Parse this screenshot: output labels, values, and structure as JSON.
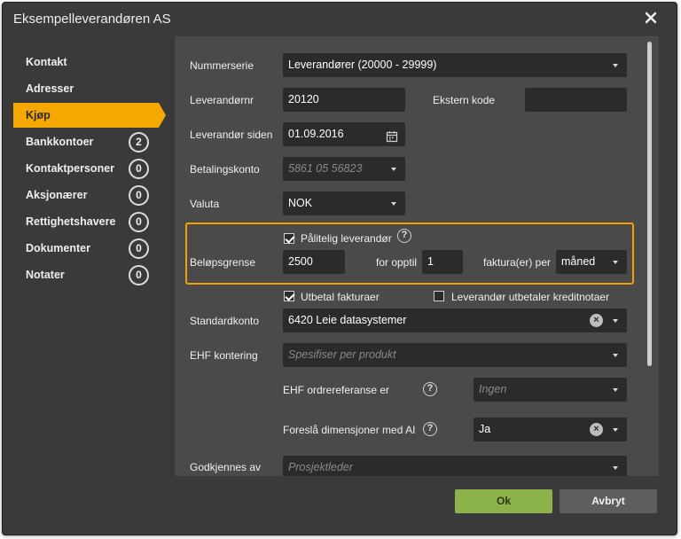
{
  "dialog": {
    "title": "Eksempelleverandøren AS"
  },
  "sidebar": {
    "items": [
      {
        "label": "Kontakt"
      },
      {
        "label": "Adresser"
      },
      {
        "label": "Kjøp"
      },
      {
        "label": "Bankkontoer",
        "count": "2"
      },
      {
        "label": "Kontaktpersoner",
        "count": "0"
      },
      {
        "label": "Aksjonærer",
        "count": "0"
      },
      {
        "label": "Rettighetshavere",
        "count": "0"
      },
      {
        "label": "Dokumenter",
        "count": "0"
      },
      {
        "label": "Notater",
        "count": "0"
      }
    ],
    "active_index": 2
  },
  "form": {
    "nummerserie": {
      "label": "Nummerserie",
      "value": "Leverandører (20000 - 29999)"
    },
    "leverandornr": {
      "label": "Leverandørnr",
      "value": "20120"
    },
    "ekstern_kode": {
      "label": "Ekstern kode",
      "value": ""
    },
    "leverandor_siden": {
      "label": "Leverandør siden",
      "value": "01.09.2016"
    },
    "betalingskonto": {
      "label": "Betalingskonto",
      "placeholder": "5861 05 56823"
    },
    "valuta": {
      "label": "Valuta",
      "value": "NOK"
    },
    "palitelig": {
      "label": "Pålitelig leverandør",
      "checked": true,
      "help": "?"
    },
    "belopsgrense": {
      "label": "Beløpsgrense",
      "value": "2500"
    },
    "for_opptil": {
      "label": "for opptil",
      "value": "1"
    },
    "fakturaer_per": {
      "label": "faktura(er) per",
      "value": "måned"
    },
    "utbetal_fakturaer": {
      "label": "Utbetal fakturaer",
      "checked": true
    },
    "kreditnotaer": {
      "label": "Leverandør utbetaler kreditnotaer",
      "checked": false
    },
    "standardkonto": {
      "label": "Standardkonto",
      "value": "6420 Leie datasystemer",
      "clear": "×"
    },
    "ehf_kontering": {
      "label": "EHF kontering",
      "placeholder": "Spesifiser per produkt"
    },
    "ehf_ordrereferanse": {
      "label": "EHF ordrereferanse er",
      "placeholder": "Ingen",
      "help": "?"
    },
    "foresla_dimensjoner": {
      "label": "Foreslå dimensjoner med AI",
      "value": "Ja",
      "help": "?",
      "clear": "×"
    },
    "godkjennes_av": {
      "label": "Godkjennes av",
      "placeholder": "Prosjektleder"
    }
  },
  "buttons": {
    "ok": "Ok",
    "cancel": "Avbryt"
  },
  "colors": {
    "accent": "#f5a800",
    "ok": "#8cb24a",
    "highlight_border": "#f5a000"
  },
  "icons": [
    "close-icon",
    "calendar-icon",
    "caret-down-icon",
    "help-icon",
    "clear-icon",
    "checkbox-icon"
  ]
}
